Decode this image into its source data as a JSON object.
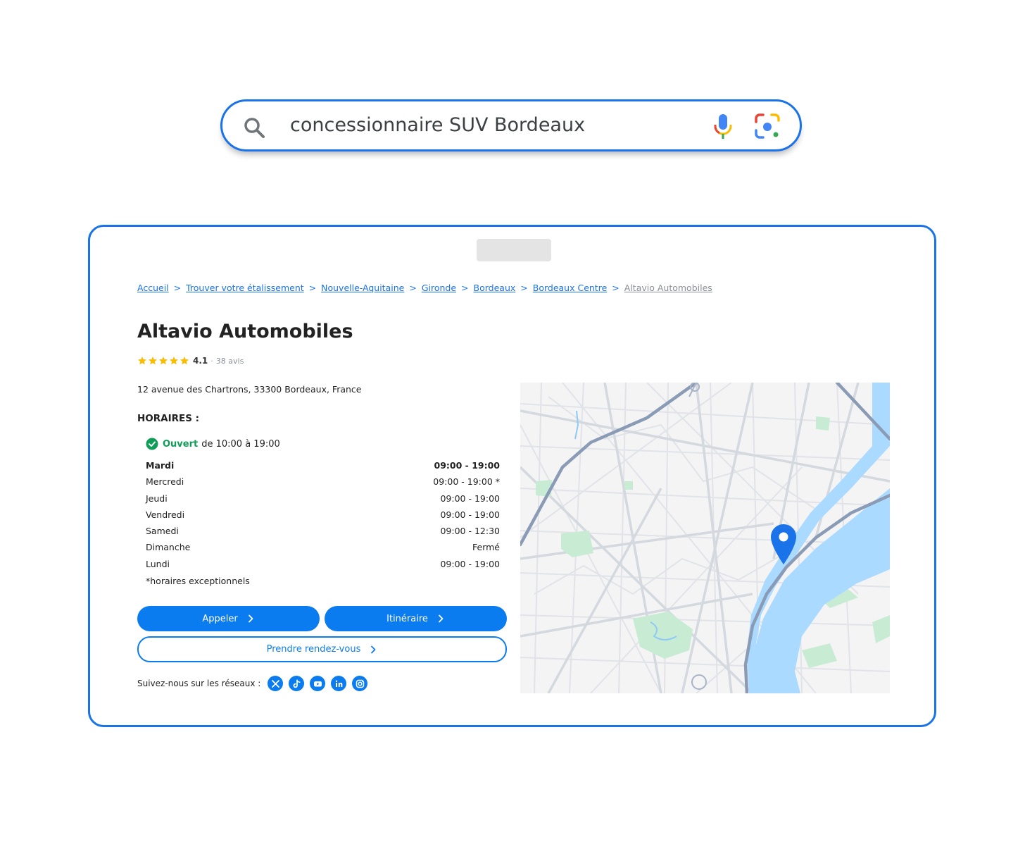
{
  "search": {
    "query": "concessionnaire SUV Bordeaux",
    "icons": {
      "search": "search-icon",
      "mic": "microphone-icon",
      "lens": "camera-lens-icon"
    }
  },
  "breadcrumb": {
    "items": [
      "Accueil",
      "Trouver votre étalissement",
      "Nouvelle-Aquitaine",
      "Gironde",
      "Bordeaux",
      "Bordeaux Centre"
    ],
    "separator": ">",
    "current": "Altavio Automobiles"
  },
  "business": {
    "name": "Altavio Automobiles",
    "rating_value": "4.1",
    "rating_stars": 5,
    "rating_dot": "·",
    "review_count": "38 avis",
    "address": "12 avenue des Chartrons, 33300 Bordeaux, France"
  },
  "hours": {
    "title": "HORAIRES :",
    "open_label": "Ouvert",
    "open_range": "de 10:00 à 19:00",
    "rows": [
      {
        "day": "Mardi",
        "time": "09:00 - 19:00",
        "today": true
      },
      {
        "day": "Mercredi",
        "time": "09:00 - 19:00 *",
        "today": false
      },
      {
        "day": "Jeudi",
        "time": "09:00 - 19:00",
        "today": false
      },
      {
        "day": "Vendredi",
        "time": "09:00 - 19:00",
        "today": false
      },
      {
        "day": "Samedi",
        "time": "09:00 - 12:30",
        "today": false
      },
      {
        "day": "Dimanche",
        "time": "Fermé",
        "today": false
      },
      {
        "day": "Lundi",
        "time": "09:00 - 19:00",
        "today": false
      }
    ],
    "note": "*horaires exceptionnels"
  },
  "actions": {
    "call_label": "Appeler",
    "route_label": "Itinéraire",
    "appointment_label": "Prendre rendez-vous"
  },
  "social": {
    "label": "Suivez-nous sur les réseaux :",
    "networks": [
      "x-icon",
      "tiktok-icon",
      "youtube-icon",
      "linkedin-icon",
      "instagram-icon"
    ]
  },
  "colors": {
    "accent": "#1a73e8",
    "button": "#0a7cf0",
    "open_green": "#0f9d58",
    "star": "#fbbc04",
    "river": "#aadaff",
    "park": "#c8ecd3",
    "road_major": "#8a9bb5"
  },
  "map": {
    "pin": "map-pin-icon"
  }
}
